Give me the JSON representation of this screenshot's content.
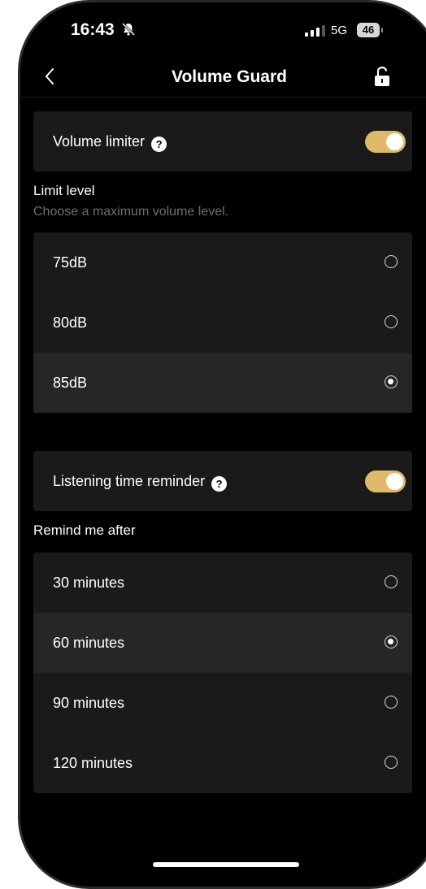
{
  "status_bar": {
    "time": "16:43",
    "network": "5G",
    "battery": "46"
  },
  "nav": {
    "title": "Volume Guard"
  },
  "volume_limiter": {
    "label": "Volume limiter",
    "help": "?",
    "enabled": true
  },
  "limit_level": {
    "title": "Limit level",
    "subtitle": "Choose a maximum volume level.",
    "options": [
      {
        "label": "75dB",
        "selected": false
      },
      {
        "label": "80dB",
        "selected": false
      },
      {
        "label": "85dB",
        "selected": true
      }
    ]
  },
  "listening_reminder": {
    "label": "Listening time reminder",
    "help": "?",
    "enabled": true
  },
  "remind_after": {
    "title": "Remind me after",
    "options": [
      {
        "label": "30 minutes",
        "selected": false
      },
      {
        "label": "60 minutes",
        "selected": true
      },
      {
        "label": "90 minutes",
        "selected": false
      },
      {
        "label": "120 minutes",
        "selected": false
      }
    ]
  },
  "colors": {
    "background": "#000000",
    "card": "#1a1a1a",
    "selected_row": "#262626",
    "toggle_on": "#e0b96a",
    "subtitle": "#6f6f6f"
  }
}
